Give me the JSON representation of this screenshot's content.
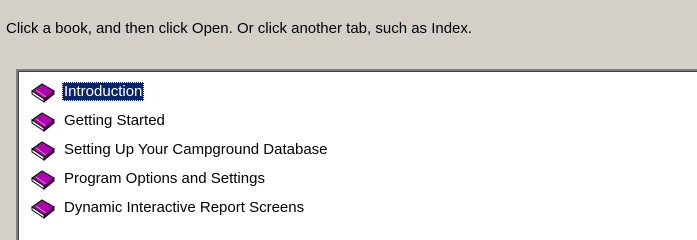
{
  "instruction": "Click a book, and then click Open. Or click another tab, such as Index.",
  "contents": {
    "items": [
      {
        "label": "Introduction",
        "selected": true,
        "icon": "closed-book-icon"
      },
      {
        "label": "Getting Started",
        "selected": false,
        "icon": "closed-book-icon"
      },
      {
        "label": "Setting Up Your Campground Database",
        "selected": false,
        "icon": "closed-book-icon"
      },
      {
        "label": "Program Options and Settings",
        "selected": false,
        "icon": "closed-book-icon"
      },
      {
        "label": "Dynamic Interactive Report Screens",
        "selected": false,
        "icon": "closed-book-icon"
      }
    ]
  },
  "colors": {
    "dialog_background": "#d4d0c8",
    "list_background": "#ffffff",
    "selection_background": "#0a246a",
    "selection_text": "#ffffff",
    "book_cover": "#800080"
  }
}
